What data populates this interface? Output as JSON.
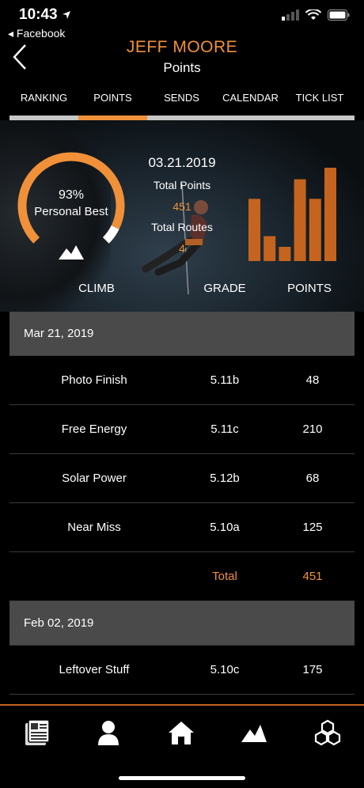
{
  "status": {
    "time": "10:43",
    "back_app": "◂ Facebook"
  },
  "header": {
    "name": "JEFF MOORE",
    "subtitle": "Points"
  },
  "tabs": [
    {
      "label": "RANKING",
      "active": false
    },
    {
      "label": "POINTS",
      "active": true
    },
    {
      "label": "SENDS",
      "active": false
    },
    {
      "label": "CALENDAR",
      "active": false
    },
    {
      "label": "TICK LIST",
      "active": false
    }
  ],
  "summary": {
    "gauge": {
      "percent": 93,
      "value_text": "93%",
      "label": "Personal Best"
    },
    "date": "03.21.2019",
    "total_points_label": "Total Points",
    "total_points": "451",
    "total_routes_label": "Total Routes",
    "total_routes": "4"
  },
  "bar_chart": {
    "color": "#c4641e",
    "values": [
      70,
      28,
      16,
      92,
      70,
      105
    ]
  },
  "columns": {
    "climb": "CLIMB",
    "grade": "GRADE",
    "points": "POINTS"
  },
  "sections": [
    {
      "date": "Mar 21, 2019",
      "rows": [
        {
          "name": "Photo Finish",
          "grade": "5.11b",
          "points": "48"
        },
        {
          "name": "Free Energy",
          "grade": "5.11c",
          "points": "210"
        },
        {
          "name": "Solar Power",
          "grade": "5.12b",
          "points": "68"
        },
        {
          "name": "Near Miss",
          "grade": "5.10a",
          "points": "125"
        }
      ],
      "total_label": "Total",
      "total": "451"
    },
    {
      "date": "Feb 02, 2019",
      "rows": [
        {
          "name": "Leftover Stuff",
          "grade": "5.10c",
          "points": "175"
        }
      ]
    }
  ],
  "tabbar": [
    "news-icon",
    "profile-icon",
    "home-icon",
    "mountain-icon",
    "hexagons-icon"
  ],
  "colors": {
    "accent": "#f0913a",
    "bar": "#c4641e",
    "section_bg": "#4a4a4a"
  }
}
